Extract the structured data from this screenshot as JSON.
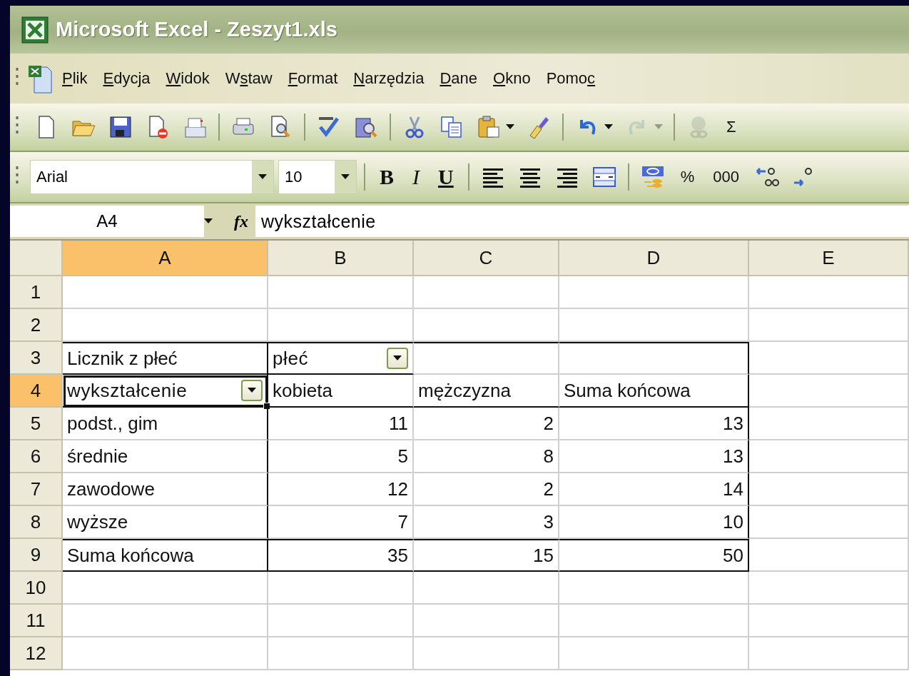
{
  "window": {
    "title": "Microsoft Excel - Zeszyt1.xls"
  },
  "menu": {
    "items": [
      {
        "key": "P",
        "post": "lik"
      },
      {
        "key": "E",
        "post": "dycja"
      },
      {
        "key": "W",
        "post": "idok"
      },
      {
        "pre": "W",
        "key": "s",
        "post": "taw"
      },
      {
        "key": "F",
        "post": "ormat"
      },
      {
        "key": "N",
        "post": "arzędzia"
      },
      {
        "key": "D",
        "post": "ane"
      },
      {
        "key": "O",
        "post": "kno"
      },
      {
        "pre": "Pomo",
        "key": "c"
      }
    ]
  },
  "standard_toolbar": {
    "items": [
      {
        "kind": "button",
        "disabled": false
      },
      {
        "kind": "button",
        "disabled": false
      },
      {
        "kind": "button",
        "disabled": false
      },
      {
        "kind": "button",
        "disabled": false
      },
      {
        "kind": "button",
        "disabled": false
      },
      {
        "kind": "separator"
      },
      {
        "kind": "button",
        "disabled": false
      },
      {
        "kind": "button",
        "disabled": false
      },
      {
        "kind": "separator"
      },
      {
        "kind": "button",
        "disabled": false
      },
      {
        "kind": "button",
        "disabled": false
      },
      {
        "kind": "separator"
      },
      {
        "kind": "button",
        "disabled": false
      },
      {
        "kind": "button",
        "disabled": false
      },
      {
        "kind": "split",
        "disabled": false
      },
      {
        "kind": "button",
        "disabled": false
      },
      {
        "kind": "separator"
      },
      {
        "kind": "split",
        "disabled": false
      },
      {
        "kind": "split",
        "disabled": true
      },
      {
        "kind": "separator"
      },
      {
        "kind": "button",
        "disabled": true
      },
      {
        "kind": "text",
        "label": "Σ",
        "disabled": false
      }
    ]
  },
  "formatting_toolbar": {
    "font_name": {
      "value": "Arial"
    },
    "font_size": {
      "value": "10"
    },
    "items": [
      {
        "kind": "separator"
      },
      {
        "kind": "bold",
        "label": "B"
      },
      {
        "kind": "italic",
        "label": "I"
      },
      {
        "kind": "underline",
        "label": "U"
      },
      {
        "kind": "separator"
      },
      {
        "kind": "button"
      },
      {
        "kind": "button"
      },
      {
        "kind": "button"
      },
      {
        "kind": "button"
      },
      {
        "kind": "separator"
      },
      {
        "kind": "button"
      },
      {
        "kind": "text",
        "label": "%"
      },
      {
        "kind": "text",
        "label": "000"
      },
      {
        "kind": "button"
      },
      {
        "kind": "button"
      }
    ]
  },
  "formula_bar": {
    "name_box": "A4",
    "function_label": "fx",
    "value": "wykształcenie"
  },
  "sheet": {
    "columns": [
      {
        "label": "A",
        "selected": true
      },
      {
        "label": "B",
        "selected": false
      },
      {
        "label": "C",
        "selected": false
      },
      {
        "label": "D",
        "selected": false
      },
      {
        "label": "E",
        "selected": false
      }
    ],
    "rows": [
      {
        "number": "1",
        "selected": false,
        "cells": [
          {},
          {},
          {},
          {},
          {}
        ]
      },
      {
        "number": "2",
        "selected": false,
        "cells": [
          {},
          {},
          {},
          {},
          {}
        ]
      },
      {
        "number": "3",
        "selected": false,
        "cells": [
          {
            "text": "Licznik z płeć",
            "kind": "text"
          },
          {
            "text": "płeć",
            "kind": "field"
          },
          {},
          {},
          {}
        ]
      },
      {
        "number": "4",
        "selected": true,
        "cells": [
          {
            "text": "wykształcenie",
            "kind": "field",
            "selected": true
          },
          {
            "text": "kobieta",
            "kind": "text"
          },
          {
            "text": "mężczyzna",
            "kind": "text"
          },
          {
            "text": "Suma końcowa",
            "kind": "text"
          },
          {}
        ]
      },
      {
        "number": "5",
        "selected": false,
        "cells": [
          {
            "text": "podst., gim",
            "kind": "text"
          },
          {
            "text": "11",
            "kind": "number"
          },
          {
            "text": "2",
            "kind": "number"
          },
          {
            "text": "13",
            "kind": "number"
          },
          {}
        ]
      },
      {
        "number": "6",
        "selected": false,
        "cells": [
          {
            "text": "średnie",
            "kind": "text"
          },
          {
            "text": "5",
            "kind": "number"
          },
          {
            "text": "8",
            "kind": "number"
          },
          {
            "text": "13",
            "kind": "number"
          },
          {}
        ]
      },
      {
        "number": "7",
        "selected": false,
        "cells": [
          {
            "text": "zawodowe",
            "kind": "text"
          },
          {
            "text": "12",
            "kind": "number"
          },
          {
            "text": "2",
            "kind": "number"
          },
          {
            "text": "14",
            "kind": "number"
          },
          {}
        ]
      },
      {
        "number": "8",
        "selected": false,
        "cells": [
          {
            "text": "wyższe",
            "kind": "text"
          },
          {
            "text": "7",
            "kind": "number"
          },
          {
            "text": "3",
            "kind": "number"
          },
          {
            "text": "10",
            "kind": "number"
          },
          {}
        ]
      },
      {
        "number": "9",
        "selected": false,
        "cells": [
          {
            "text": "Suma końcowa",
            "kind": "text"
          },
          {
            "text": "35",
            "kind": "number"
          },
          {
            "text": "15",
            "kind": "number"
          },
          {
            "text": "50",
            "kind": "number"
          },
          {}
        ]
      },
      {
        "number": "10",
        "selected": false,
        "cells": [
          {},
          {},
          {},
          {},
          {}
        ]
      },
      {
        "number": "11",
        "selected": false,
        "cells": [
          {},
          {},
          {},
          {},
          {}
        ]
      },
      {
        "number": "12",
        "selected": false,
        "cells": [
          {},
          {},
          {},
          {},
          {}
        ]
      }
    ]
  }
}
